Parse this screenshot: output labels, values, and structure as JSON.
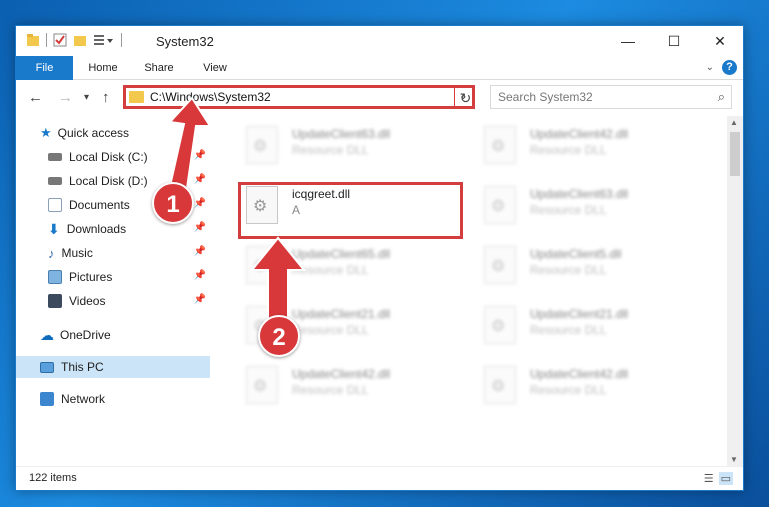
{
  "window": {
    "title": "System32",
    "minimize_icon": "minimize-icon",
    "maximize_icon": "maximize-icon",
    "close_icon": "close-icon"
  },
  "ribbon": {
    "tabs": [
      "File",
      "Home",
      "Share",
      "View"
    ],
    "help_label": "?"
  },
  "nav": {
    "address": "C:\\Windows\\System32",
    "search_placeholder": "Search System32",
    "refresh_glyph": "↻"
  },
  "sidebar": {
    "items": [
      {
        "label": "Quick access",
        "icon": "star-icon",
        "pinned": false
      },
      {
        "label": "Local Disk (C:)",
        "icon": "disk-icon",
        "pinned": true
      },
      {
        "label": "Local Disk (D:)",
        "icon": "disk-icon",
        "pinned": true
      },
      {
        "label": "Documents",
        "icon": "documents-icon",
        "pinned": true
      },
      {
        "label": "Downloads",
        "icon": "downloads-icon",
        "pinned": true
      },
      {
        "label": "Music",
        "icon": "music-icon",
        "pinned": true
      },
      {
        "label": "Pictures",
        "icon": "pictures-icon",
        "pinned": true
      },
      {
        "label": "Videos",
        "icon": "videos-icon",
        "pinned": true
      },
      {
        "label": "OneDrive",
        "icon": "cloud-icon",
        "pinned": false
      },
      {
        "label": "This PC",
        "icon": "pc-icon",
        "pinned": false
      },
      {
        "label": "Network",
        "icon": "network-icon",
        "pinned": false
      }
    ]
  },
  "files": {
    "left": [
      {
        "name": "UpdateClient63.dll",
        "desc": "Resource DLL"
      },
      {
        "name": "icqgreet.dll",
        "desc": "A"
      },
      {
        "name": "UpdateClient65.dll",
        "desc": "Resource DLL"
      },
      {
        "name": "UpdateClient21.dll",
        "desc": "Resource DLL"
      },
      {
        "name": "UpdateClient42.dll",
        "desc": "Resource DLL"
      }
    ],
    "right": [
      {
        "name": "UpdateClient42.dll",
        "desc": "Resource DLL"
      },
      {
        "name": "UpdateClient63.dll",
        "desc": "Resource DLL"
      },
      {
        "name": "UpdateClient5.dll",
        "desc": "Resource DLL"
      },
      {
        "name": "UpdateClient21.dll",
        "desc": "Resource DLL"
      },
      {
        "name": "UpdateClient42.dll",
        "desc": "Resource DLL"
      }
    ]
  },
  "status": {
    "item_count": "122 items"
  },
  "callouts": [
    "1",
    "2"
  ],
  "colors": {
    "accent": "#1979ca",
    "highlight": "#d33d3d",
    "callout": "#d9383a"
  }
}
